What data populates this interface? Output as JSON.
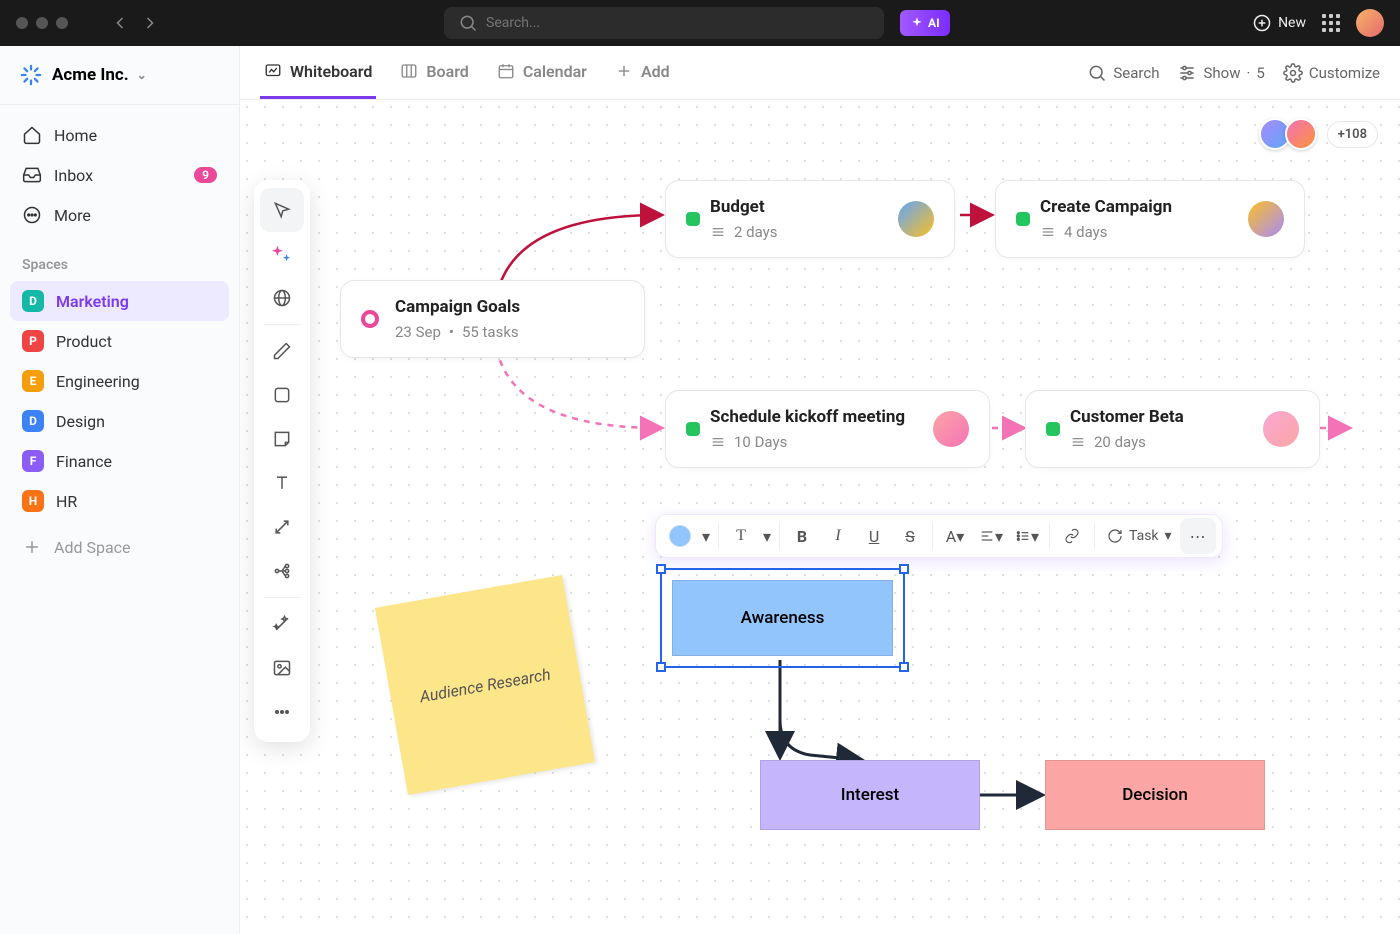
{
  "titlebar": {
    "search_placeholder": "Search...",
    "ai_label": "AI",
    "new_label": "New"
  },
  "workspace": {
    "name": "Acme Inc."
  },
  "nav": {
    "home": "Home",
    "inbox": "Inbox",
    "inbox_badge": "9",
    "more": "More"
  },
  "spaces_label": "Spaces",
  "spaces": [
    {
      "letter": "D",
      "color": "#14b8a6",
      "label": "Marketing",
      "active": true
    },
    {
      "letter": "P",
      "color": "#ef4444",
      "label": "Product"
    },
    {
      "letter": "E",
      "color": "#f59e0b",
      "label": "Engineering"
    },
    {
      "letter": "D",
      "color": "#3b82f6",
      "label": "Design"
    },
    {
      "letter": "F",
      "color": "#8b5cf6",
      "label": "Finance"
    },
    {
      "letter": "H",
      "color": "#f97316",
      "label": "HR"
    }
  ],
  "add_space": "Add Space",
  "views": {
    "whiteboard": "Whiteboard",
    "board": "Board",
    "calendar": "Calendar",
    "add": "Add"
  },
  "view_actions": {
    "search": "Search",
    "show": "Show",
    "show_count": "5",
    "customize": "Customize"
  },
  "collab_more": "+108",
  "cards": {
    "goals": {
      "title": "Campaign Goals",
      "date": "23 Sep",
      "tasks": "55 tasks"
    },
    "budget": {
      "title": "Budget",
      "duration": "2 days"
    },
    "campaign": {
      "title": "Create Campaign",
      "duration": "4 days"
    },
    "kickoff": {
      "title": "Schedule kickoff meeting",
      "duration": "10 Days"
    },
    "beta": {
      "title": "Customer Beta",
      "duration": "20 days"
    }
  },
  "sticky": {
    "text": "Audience Research"
  },
  "toolbar": {
    "task_label": "Task"
  },
  "flow": {
    "awareness": "Awareness",
    "interest": "Interest",
    "decision": "Decision"
  }
}
